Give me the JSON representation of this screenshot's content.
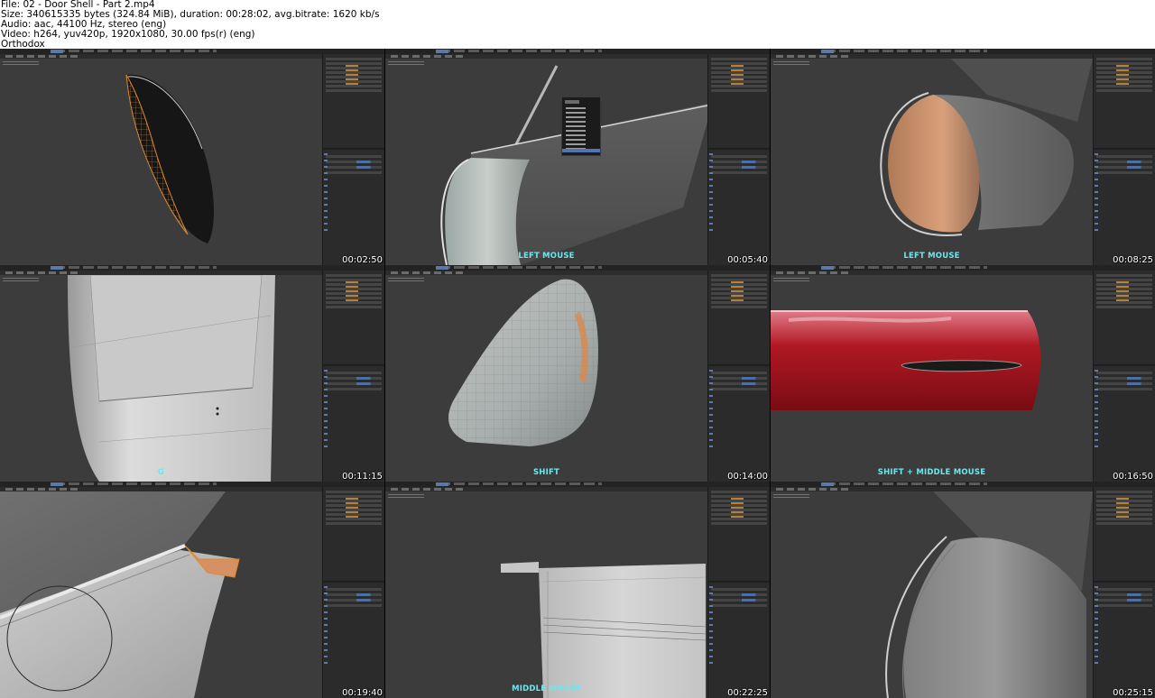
{
  "header_lines": [
    "File: 02 - Door Shell - Part 2.mp4",
    "Size: 340615335 bytes (324.84 MiB), duration: 00:28:02, avg.bitrate: 1620 kb/s",
    "Audio: aac, 44100 Hz, stereo (eng)",
    "Video: h264, yuv420p, 1920x1080, 30.00 fps(r) (eng)",
    "Orthodox"
  ],
  "thumbnails": [
    {
      "timestamp": "00:02:50",
      "caption": ""
    },
    {
      "timestamp": "00:05:40",
      "caption": "LEFT MOUSE"
    },
    {
      "timestamp": "00:08:25",
      "caption": "LEFT MOUSE"
    },
    {
      "timestamp": "00:11:15",
      "caption": "G"
    },
    {
      "timestamp": "00:14:00",
      "caption": "SHIFT"
    },
    {
      "timestamp": "00:16:50",
      "caption": "SHIFT + MIDDLE MOUSE"
    },
    {
      "timestamp": "00:19:40",
      "caption": ""
    },
    {
      "timestamp": "00:22:25",
      "caption": "MIDDLE MOUSE"
    },
    {
      "timestamp": "00:25:15",
      "caption": ""
    }
  ],
  "colors": {
    "caption": "#6fe6ea",
    "viewport_bg": "#3c3c3c",
    "selection_orange": "#e08a2c",
    "menu_highlight": "#5174b3",
    "car_red": "#b01822"
  }
}
